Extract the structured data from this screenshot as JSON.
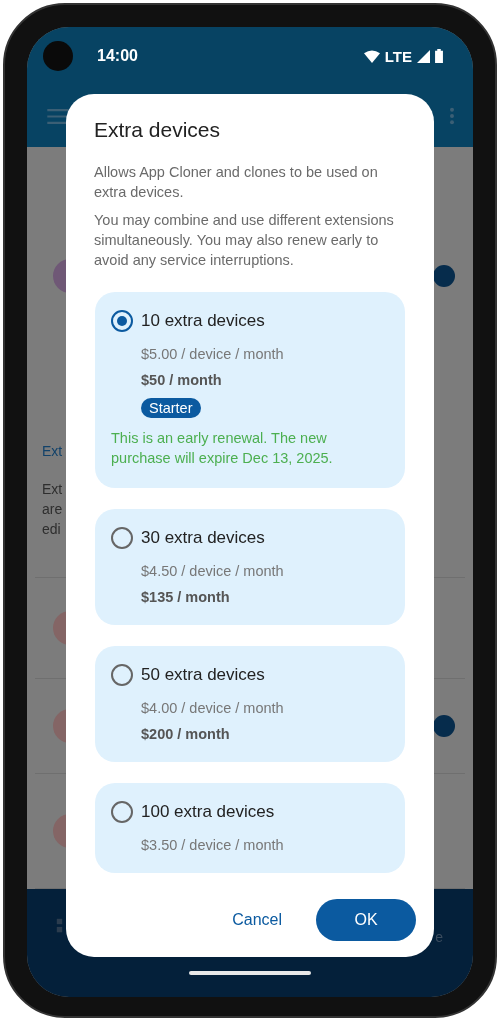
{
  "status_bar": {
    "time": "14:00",
    "network": "LTE"
  },
  "background": {
    "section_heading": "Ext",
    "description_lines": [
      "Ext",
      "are",
      "edi"
    ],
    "bottom_nav_fragment": "e"
  },
  "dialog": {
    "title": "Extra devices",
    "paragraphs": [
      "Allows App Cloner and clones to be used on extra devices.",
      "You may combine and use different extensions simultaneously. You may also renew early to avoid any service interruptions."
    ],
    "options": [
      {
        "label": "10 extra devices",
        "per_device": "$5.00 / device / month",
        "monthly": "$50 / month",
        "badge": "Starter",
        "note": "This is an early renewal. The new purchase will expire Dec 13, 2025.",
        "selected": true
      },
      {
        "label": "30 extra devices",
        "per_device": "$4.50 / device / month",
        "monthly": "$135 / month",
        "selected": false
      },
      {
        "label": "50 extra devices",
        "per_device": "$4.00 / device / month",
        "monthly": "$200 / month",
        "selected": false
      },
      {
        "label": "100 extra devices",
        "per_device": "$3.50 / device / month",
        "selected": false
      }
    ],
    "buttons": [
      {
        "label": "Cancel",
        "kind": "text"
      },
      {
        "label": "OK",
        "kind": "filled"
      }
    ]
  }
}
